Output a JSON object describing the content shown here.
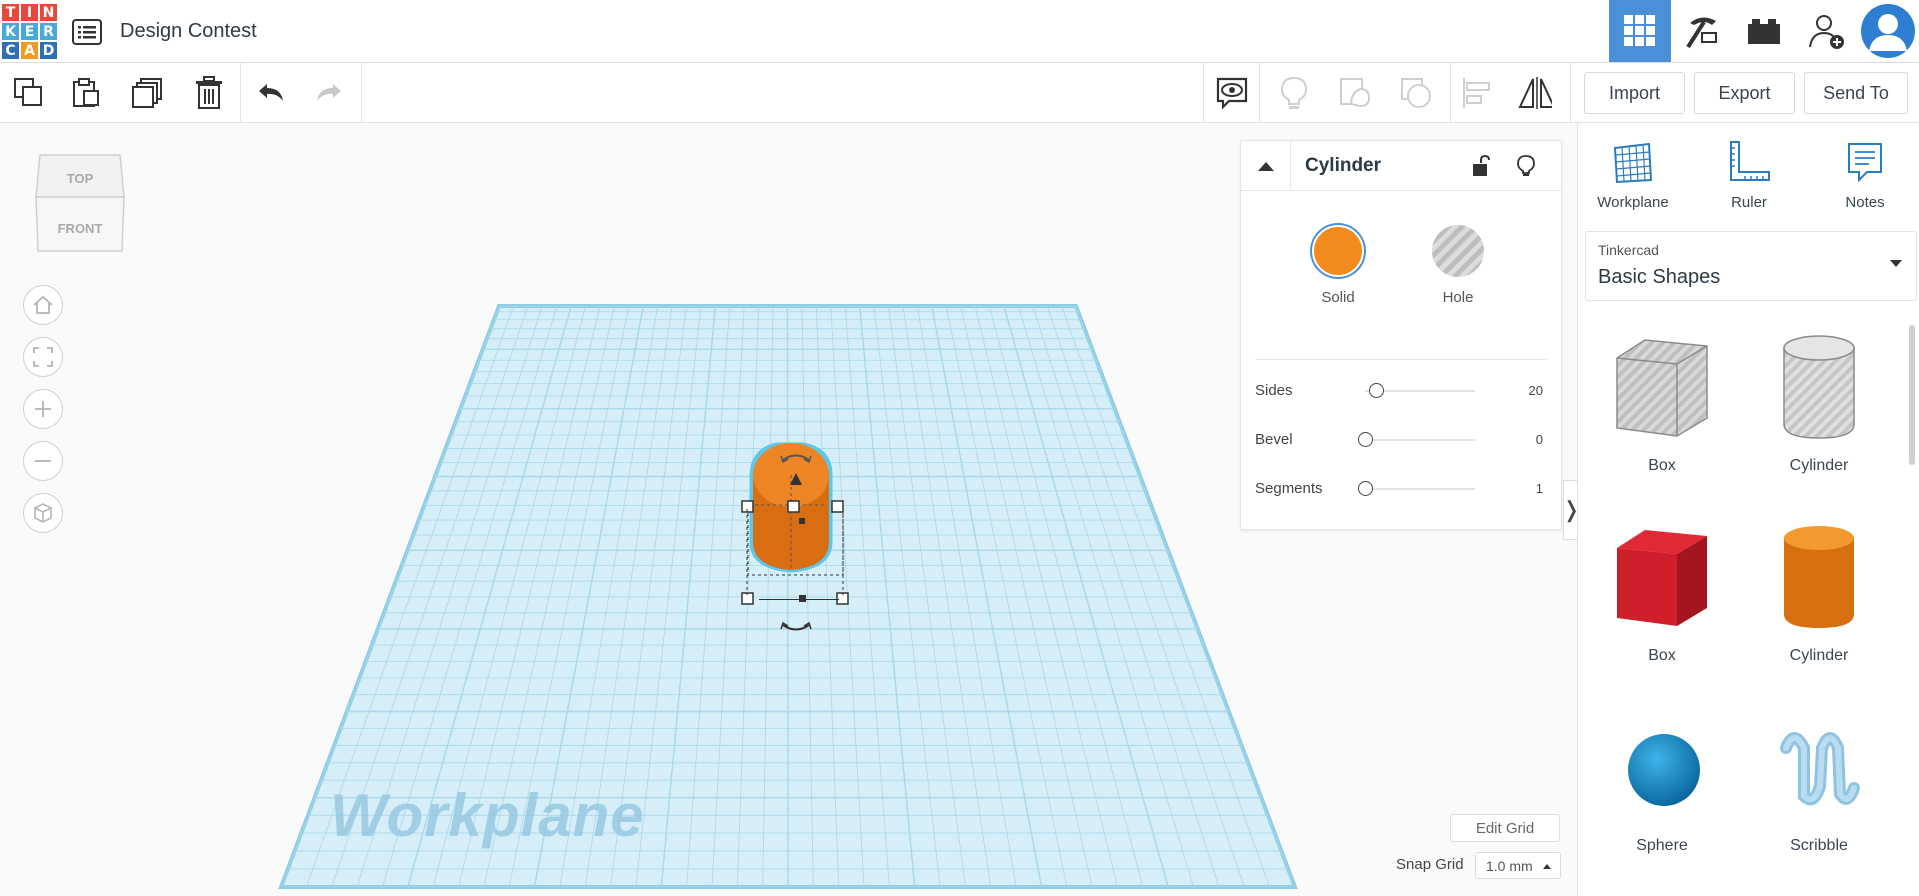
{
  "app": {
    "logo_letters": [
      "T",
      "I",
      "N",
      "K",
      "E",
      "R",
      "C",
      "A",
      "D"
    ],
    "logo_colors": [
      "#e8483c",
      "#e8483c",
      "#e8483c",
      "#4aa8d8",
      "#4aa8d8",
      "#4aa8d8",
      "#2f6fb5",
      "#f29a22",
      "#2f6fb5"
    ],
    "design_title": "Design Contest"
  },
  "header": {
    "mode_buttons": [
      "3d-design-grid-icon",
      "codeblocks-pickaxe-icon",
      "bricks-icon",
      "add-user-icon",
      "user-avatar-icon"
    ],
    "active_mode": "3d-design-grid-icon",
    "accent_color": "#4a90d9"
  },
  "toolbar": {
    "icons_left": [
      "copy-icon",
      "paste-icon",
      "duplicate-icon",
      "trash-icon",
      "undo-icon",
      "redo-icon"
    ],
    "icons_right": [
      "show-hide-icon",
      "lightbulb-icon",
      "group-icon",
      "ungroup-icon",
      "align-icon",
      "mirror-icon"
    ],
    "import_label": "Import",
    "export_label": "Export",
    "send_to_label": "Send To"
  },
  "viewcube": {
    "top_label": "TOP",
    "front_label": "FRONT"
  },
  "nav_controls": [
    "home-icon",
    "fit-view-icon",
    "zoom-in-icon",
    "zoom-out-icon",
    "perspective-cube-icon"
  ],
  "workplane": {
    "label": "Workplane",
    "grid_color": "#a8d8ea"
  },
  "inspector": {
    "title": "Cylinder",
    "solid_label": "Solid",
    "hole_label": "Hole",
    "solid_color": "#f28b1e",
    "properties": [
      {
        "name": "Sides",
        "value": "20",
        "fraction": 0.1
      },
      {
        "name": "Bevel",
        "value": "0",
        "fraction": 0.0
      },
      {
        "name": "Segments",
        "value": "1",
        "fraction": 0.0
      }
    ]
  },
  "grid_controls": {
    "edit_grid_label": "Edit Grid",
    "snap_grid_label": "Snap Grid",
    "snap_grid_value": "1.0 mm"
  },
  "right_panel": {
    "tools": [
      {
        "label": "Workplane",
        "icon": "workplane-icon"
      },
      {
        "label": "Ruler",
        "icon": "ruler-icon"
      },
      {
        "label": "Notes",
        "icon": "notes-icon"
      }
    ],
    "category_source": "Tinkercad",
    "category_name": "Basic Shapes",
    "shapes": [
      {
        "name": "Box",
        "style": "hole"
      },
      {
        "name": "Cylinder",
        "style": "hole"
      },
      {
        "name": "Box",
        "style": "red"
      },
      {
        "name": "Cylinder",
        "style": "orange"
      },
      {
        "name": "Sphere",
        "style": "blue"
      },
      {
        "name": "Scribble",
        "style": "lightblue"
      }
    ]
  }
}
